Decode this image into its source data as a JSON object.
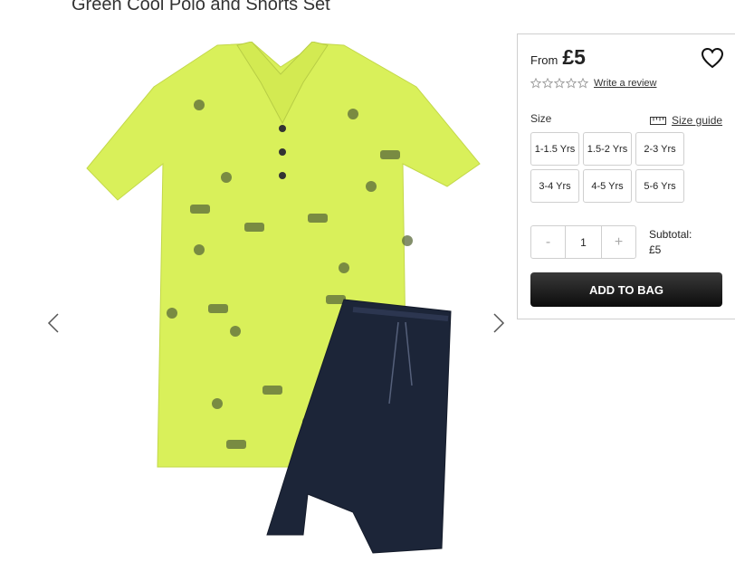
{
  "product": {
    "title": "Green Cool Polo and Shorts Set"
  },
  "gallery": {
    "prev_icon": "chevron-left-icon",
    "next_icon": "chevron-right-icon",
    "polo_color": "#d9f05a",
    "shorts_color": "#1c2538"
  },
  "purchase": {
    "from_label": "From",
    "price": "£5",
    "wishlist_icon": "heart-icon",
    "rating": {
      "stars_filled": 0,
      "stars_total": 5,
      "review_link": "Write a review"
    },
    "size_label": "Size",
    "size_guide_label": "Size guide",
    "size_guide_icon": "ruler-icon",
    "sizes": [
      "1-1.5 Yrs",
      "1.5-2 Yrs",
      "2-3 Yrs",
      "3-4 Yrs",
      "4-5 Yrs",
      "5-6 Yrs"
    ],
    "quantity": {
      "minus_label": "-",
      "value": "1",
      "plus_label": "+"
    },
    "subtotal_label": "Subtotal:",
    "subtotal_value": "£5",
    "add_to_bag_label": "ADD TO BAG"
  }
}
